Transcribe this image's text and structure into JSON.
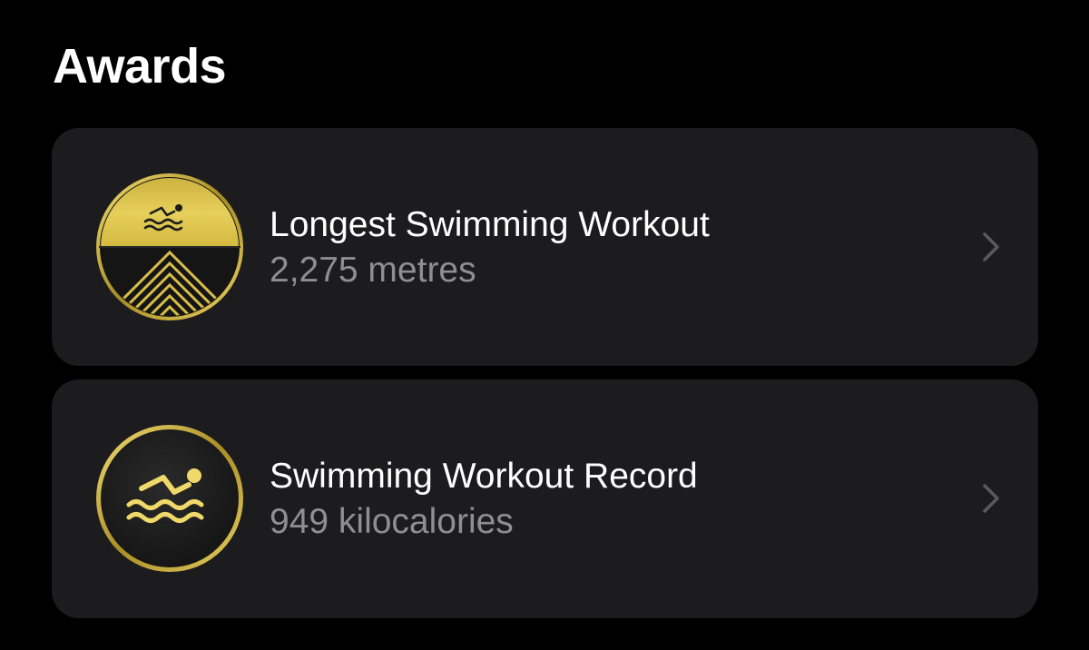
{
  "header": {
    "title": "Awards"
  },
  "awards": [
    {
      "title": "Longest Swimming Workout",
      "value": "2,275 metres",
      "icon": "swimmer-mountain-medal-icon"
    },
    {
      "title": "Swimming Workout Record",
      "value": "949 kilocalories",
      "icon": "swimmer-medal-icon"
    }
  ],
  "colors": {
    "background": "#000000",
    "card": "#1c1c1e",
    "primary_text": "#ffffff",
    "secondary_text": "#8e8e93",
    "gold": "#d9c04a"
  }
}
